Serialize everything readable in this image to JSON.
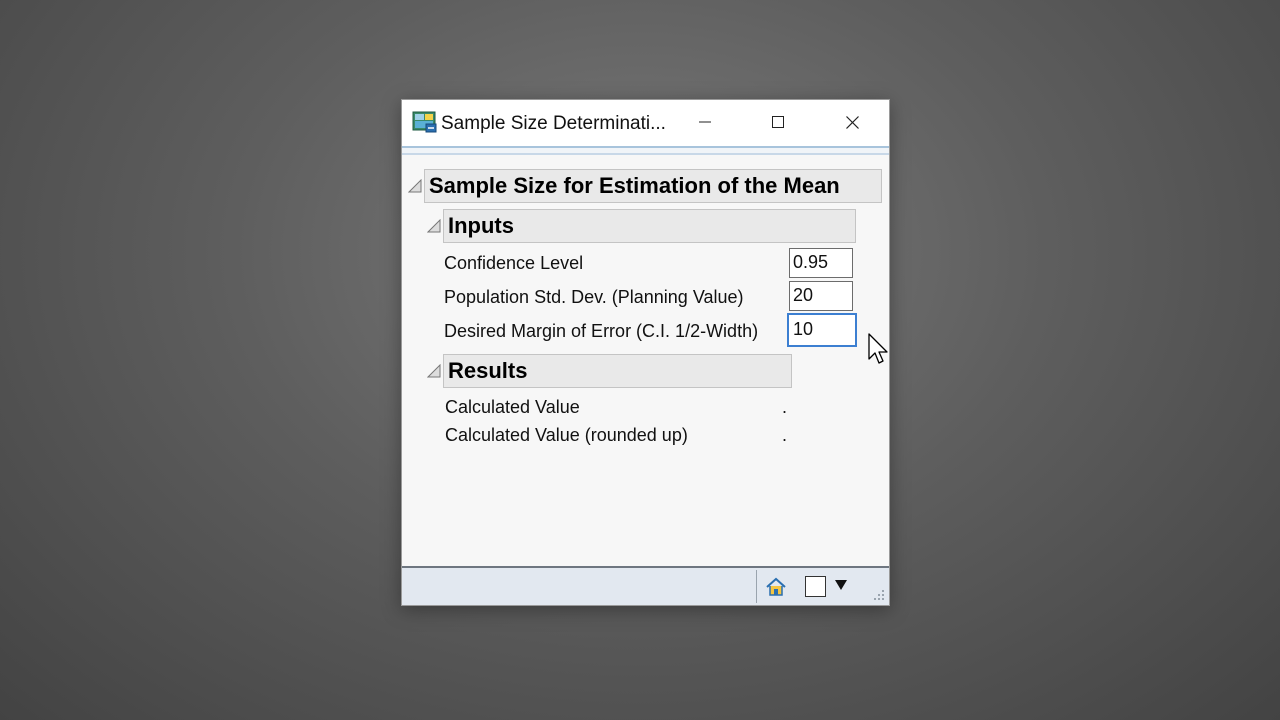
{
  "window": {
    "title": "Sample Size Determinati...",
    "icons": {
      "app": "jmp-app-icon",
      "minimize": "minimize-icon",
      "maximize": "maximize-icon",
      "close": "close-icon"
    }
  },
  "report": {
    "title": "Sample Size for Estimation of the Mean",
    "inputs": {
      "heading": "Inputs",
      "confidence_label": "Confidence Level",
      "confidence_value": "0.95",
      "stddev_label": "Population Std. Dev. (Planning Value)",
      "stddev_value": "20",
      "margin_label": "Desired Margin of Error (C.I. 1/2-Width)",
      "margin_value": "10"
    },
    "results": {
      "heading": "Results",
      "calc_label": "Calculated Value",
      "calc_value": ".",
      "rounded_label": "Calculated Value (rounded up)",
      "rounded_value": "."
    }
  },
  "statusbar": {
    "icons": [
      "home-icon",
      "selection-box-icon",
      "dropdown-arrow-icon",
      "resize-grip-icon"
    ]
  },
  "colors": {
    "focus_border": "#3c7fd1",
    "header_bg": "#e9e9e9",
    "statusbar_bg": "#e2e8f0"
  }
}
